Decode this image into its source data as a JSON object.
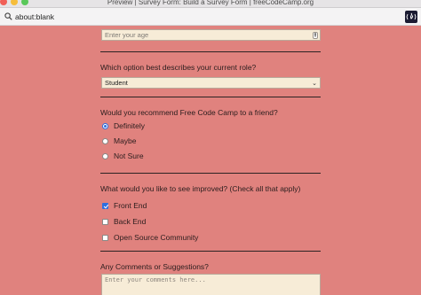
{
  "window": {
    "title": "Preview | Survey Form: Build a Survey Form | freeCodeCamp.org"
  },
  "browser": {
    "url": "about:blank",
    "logo_icon": "freecodecamp-logo-icon"
  },
  "form": {
    "age_input": {
      "placeholder": "Enter your age"
    },
    "role": {
      "question": "Which option best describes your current role?",
      "selected": "Student"
    },
    "recommend": {
      "question": "Would you recommend Free Code Camp to a friend?",
      "options": [
        {
          "label": "Definitely",
          "checked": true
        },
        {
          "label": "Maybe",
          "checked": false
        },
        {
          "label": "Not Sure",
          "checked": false
        }
      ]
    },
    "improve": {
      "question": "What would you like to see improved? (Check all that apply)",
      "options": [
        {
          "label": "Front End",
          "checked": true
        },
        {
          "label": "Back End",
          "checked": false
        },
        {
          "label": "Open Source Community",
          "checked": false
        }
      ]
    },
    "comments": {
      "question": "Any Comments or Suggestions?",
      "placeholder": "Enter your comments here..."
    }
  },
  "colors": {
    "page_background": "#e0827e",
    "field_background": "#f7ecd7",
    "accent": "#2f6fe0"
  }
}
